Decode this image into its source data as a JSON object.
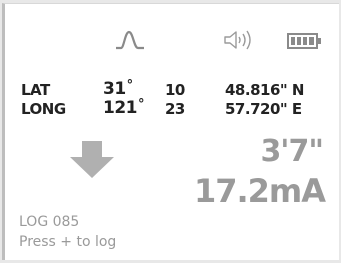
{
  "status": {
    "signal_icon": "pulse-icon",
    "sound_icon": "speaker-icon",
    "battery_icon": "battery-icon",
    "battery_level": 1.0
  },
  "latitude": {
    "label": "LAT",
    "degrees": "31",
    "degree_symbol": "°",
    "minutes": "10",
    "seconds": "48.816\" N"
  },
  "longitude": {
    "label": "LONG",
    "degrees": "121",
    "degree_symbol": "°",
    "minutes": "23",
    "seconds": "57.720\" E"
  },
  "direction": {
    "icon": "arrow-down-icon"
  },
  "readouts": {
    "distance": "3'7\"",
    "current": "17.2mA"
  },
  "log": {
    "number": "LOG 085",
    "prompt": "Press + to log"
  },
  "colors": {
    "dark_text": "#222222",
    "light_text": "#9a9a9a",
    "icon_gray": "#8a8a8a",
    "arrow_gray": "#b0b0b0"
  }
}
